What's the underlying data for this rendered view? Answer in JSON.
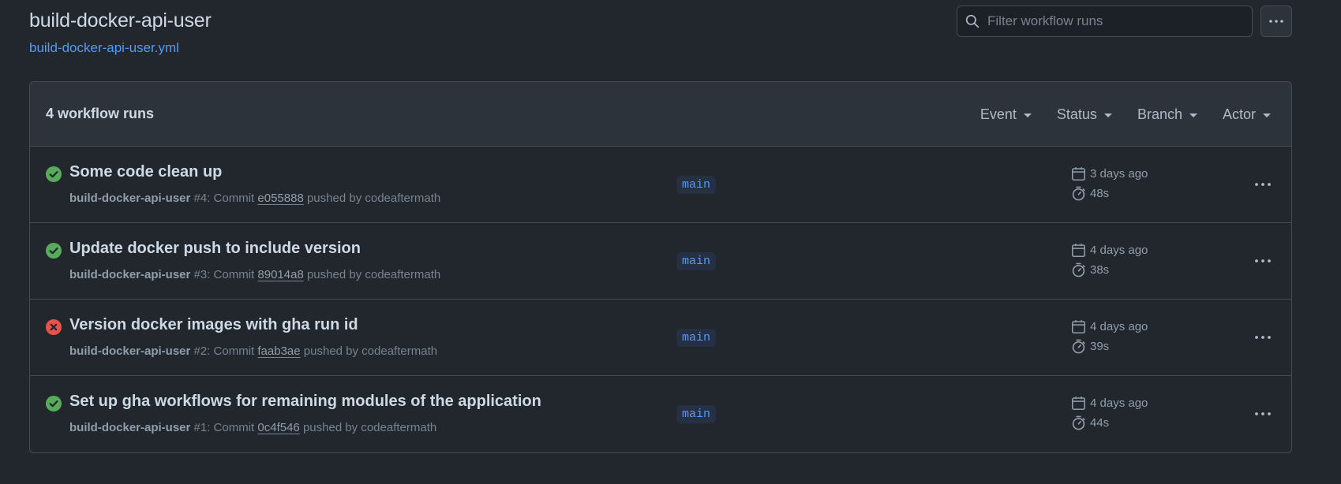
{
  "workflow": {
    "title": "build-docker-api-user",
    "file": "build-docker-api-user.yml"
  },
  "search": {
    "placeholder": "Filter workflow runs"
  },
  "runs_header": {
    "count_label": "4 workflow runs",
    "filters": [
      "Event",
      "Status",
      "Branch",
      "Actor"
    ]
  },
  "runs": [
    {
      "status": "success",
      "title": "Some code clean up",
      "workflow_name": "build-docker-api-user",
      "run_number": "#4",
      "commit_prefix": ": Commit",
      "sha": "e055888",
      "pushed_by": "pushed by codeaftermath",
      "branch": "main",
      "when": "3 days ago",
      "duration": "48s"
    },
    {
      "status": "success",
      "title": "Update docker push to include version",
      "workflow_name": "build-docker-api-user",
      "run_number": "#3",
      "commit_prefix": ": Commit",
      "sha": "89014a8",
      "pushed_by": "pushed by codeaftermath",
      "branch": "main",
      "when": "4 days ago",
      "duration": "38s"
    },
    {
      "status": "failure",
      "title": "Version docker images with gha run id",
      "workflow_name": "build-docker-api-user",
      "run_number": "#2",
      "commit_prefix": ": Commit",
      "sha": "faab3ae",
      "pushed_by": "pushed by codeaftermath",
      "branch": "main",
      "when": "4 days ago",
      "duration": "39s"
    },
    {
      "status": "success",
      "title": "Set up gha workflows for remaining modules of the application",
      "workflow_name": "build-docker-api-user",
      "run_number": "#1",
      "commit_prefix": ": Commit",
      "sha": "0c4f546",
      "pushed_by": "pushed by codeaftermath",
      "branch": "main",
      "when": "4 days ago",
      "duration": "44s"
    }
  ],
  "colors": {
    "success": "#57ab5a",
    "failure": "#e5534b",
    "link": "#539bf5",
    "background": "#22272e"
  },
  "icons": {
    "search": "search-icon",
    "more": "kebab-horizontal-icon",
    "calendar": "calendar-icon",
    "stopwatch": "stopwatch-icon",
    "success": "check-circle-fill-icon",
    "failure": "x-circle-fill-icon"
  }
}
